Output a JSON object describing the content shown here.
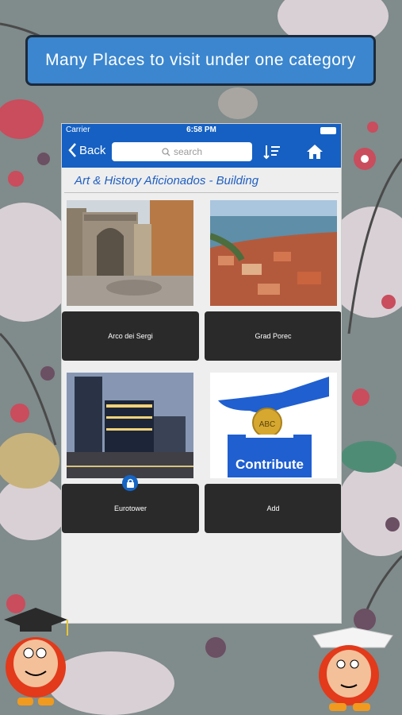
{
  "banner": {
    "text": "Many Places to visit under one category"
  },
  "status_bar": {
    "carrier": "Carrier",
    "time": "6:58 PM"
  },
  "nav": {
    "back_label": "Back",
    "search_placeholder": "search"
  },
  "subtitle": "Art & History Aficionados - Building",
  "cards": [
    {
      "label": "Arco dei Sergi"
    },
    {
      "label": "Grad Porec"
    },
    {
      "label": "Eurotower"
    },
    {
      "label": "Add"
    }
  ],
  "contribute_label": "Contribute",
  "coin_letters": "ABC",
  "colors": {
    "accent": "#1560c2",
    "card_bg": "#2a2a2b",
    "banner": "#3b86cf"
  }
}
